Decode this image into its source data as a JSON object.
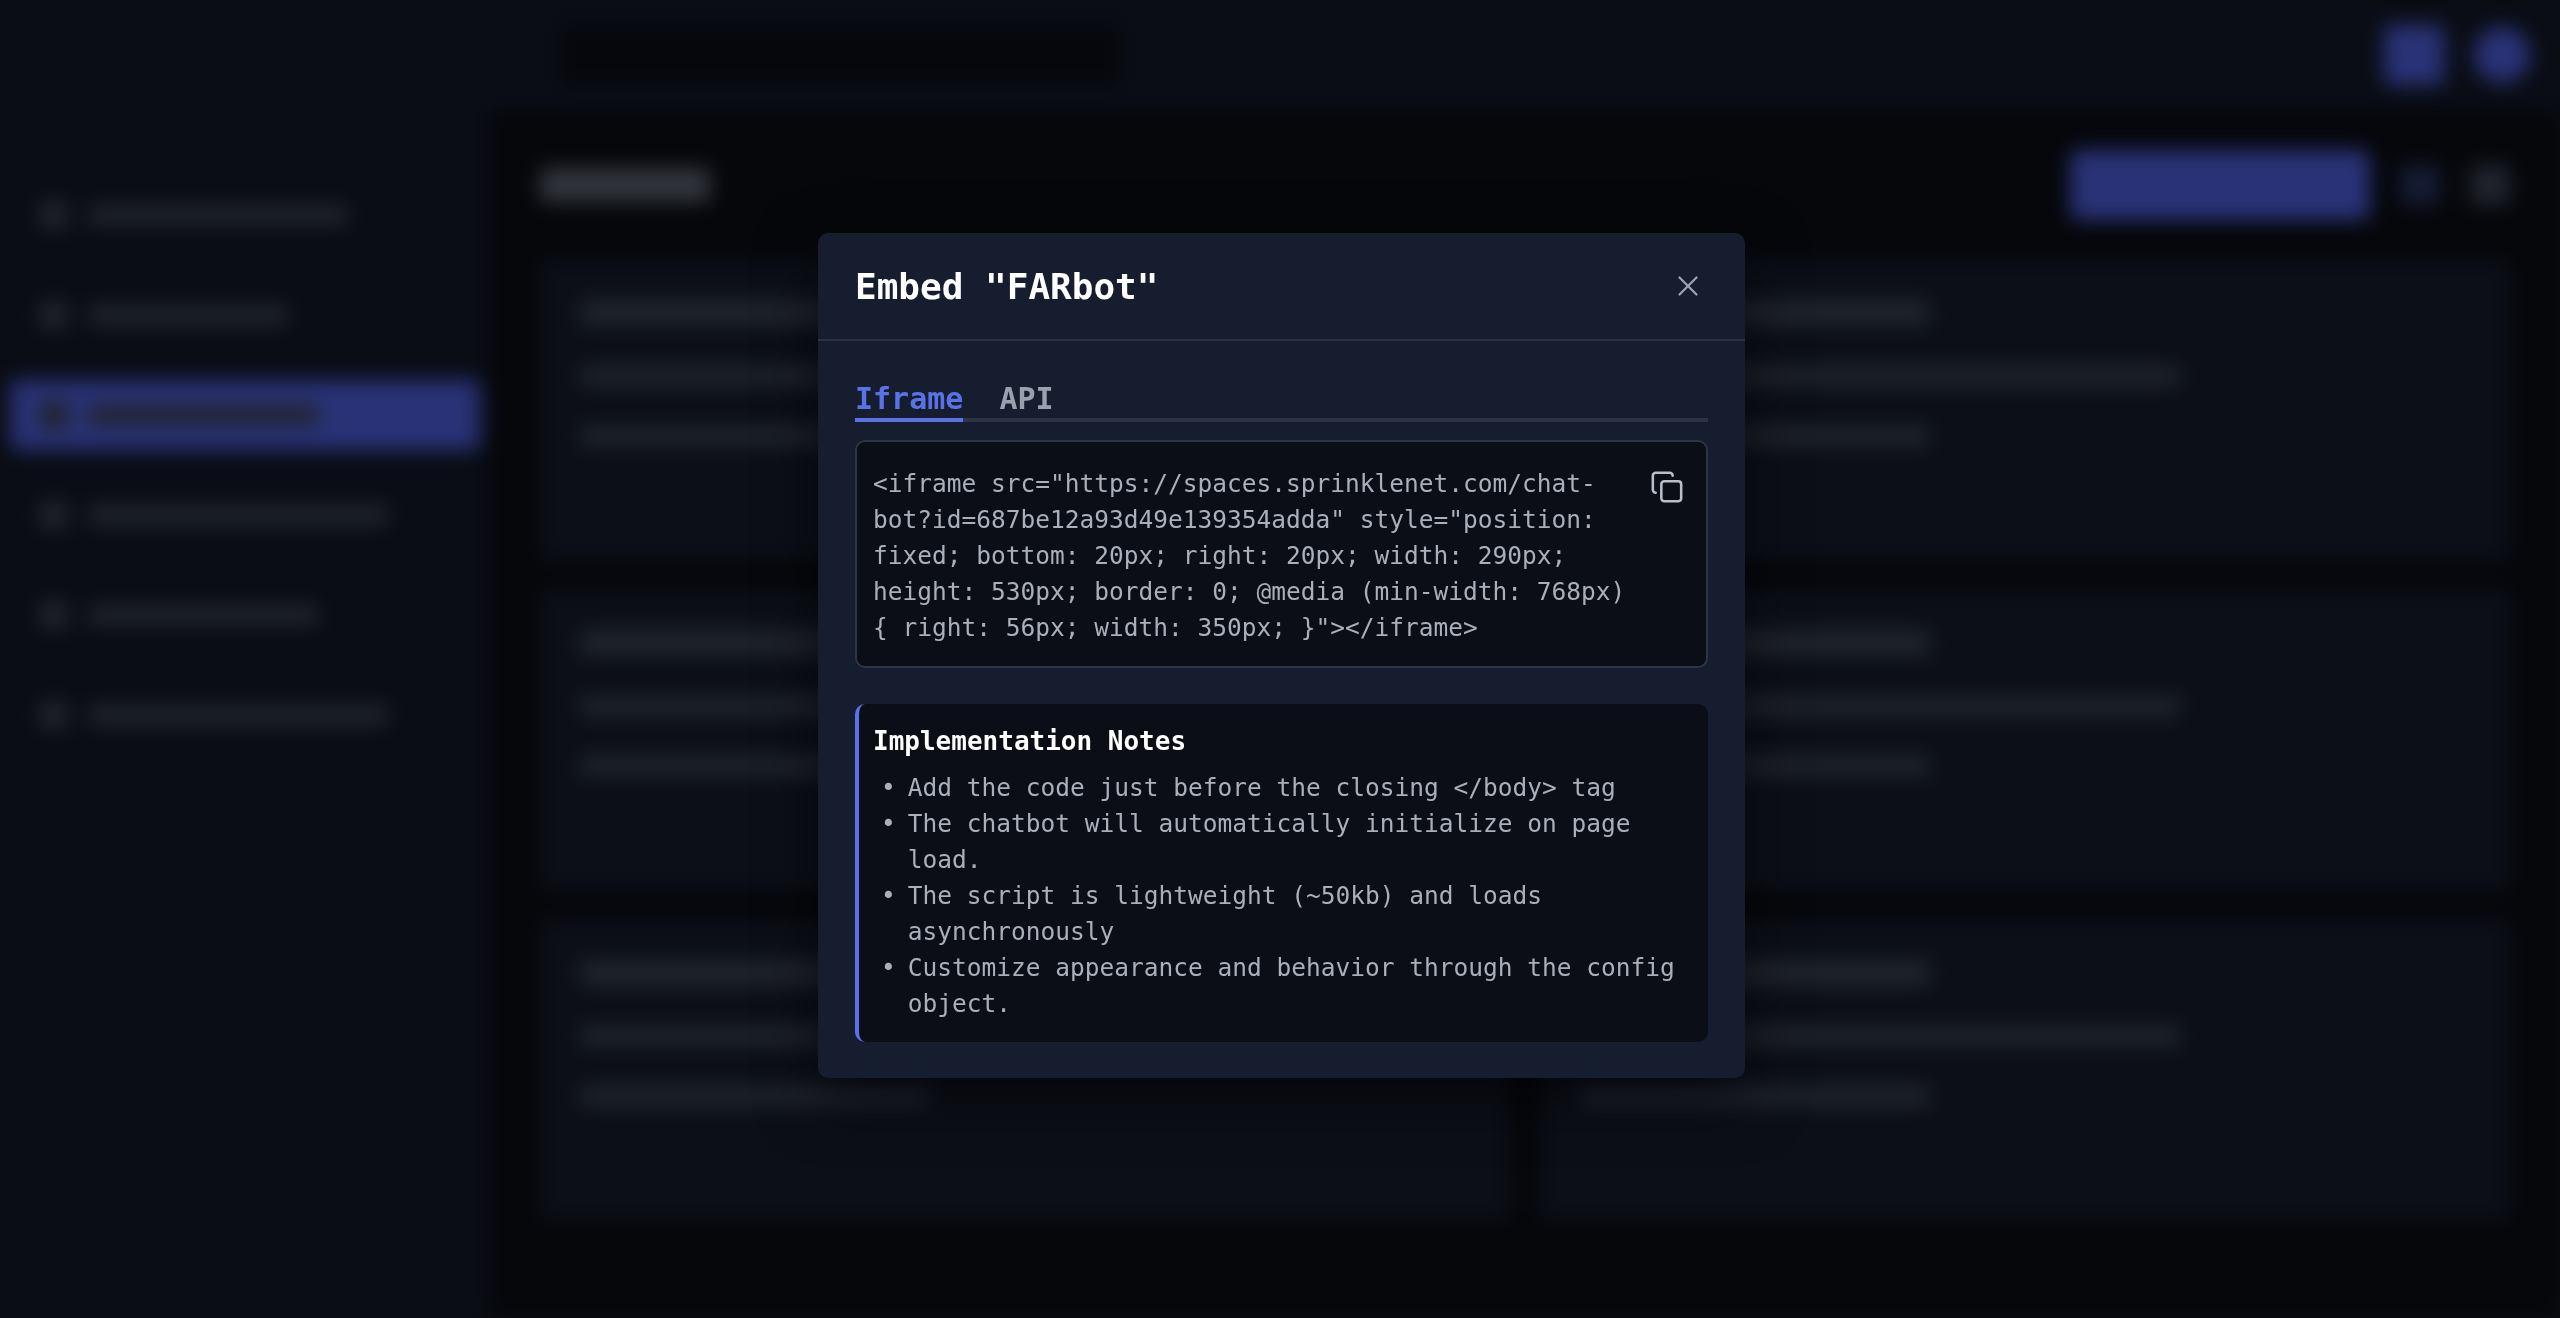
{
  "modal": {
    "title": "Embed \"FARbot\"",
    "tabs": [
      {
        "label": "Iframe",
        "selected": true
      },
      {
        "label": "API",
        "selected": false
      }
    ],
    "code": "<iframe src=\"https://spaces.sprinklenet.com/chat-bot?id=687be12a93d49e139354adda\" style=\"position: fixed; bottom: 20px; right: 20px; width: 290px; height: 530px; border: 0; @media (min-width: 768px) { right: 56px; width: 350px; }\"></iframe>",
    "notes": {
      "title": "Implementation Notes",
      "bullet": "•",
      "items": [
        "Add the code just before the closing </body> tag",
        "The chatbot will automatically initialize on page load.",
        "The script is lightweight (~50kb) and loads asynchronously",
        "Customize appearance and behavior through the config object."
      ]
    }
  }
}
